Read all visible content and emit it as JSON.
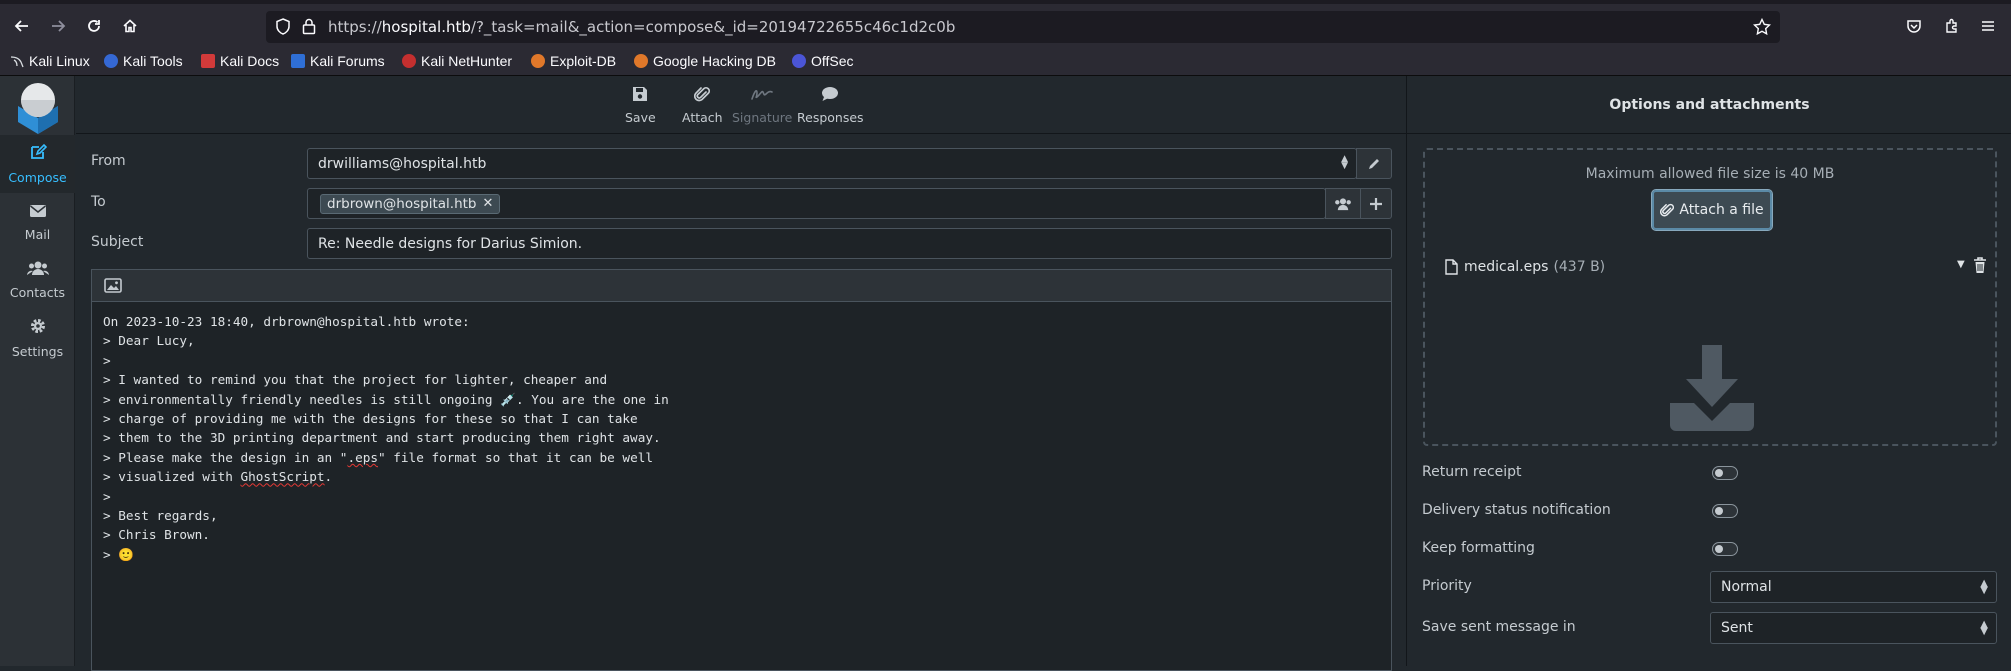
{
  "browser": {
    "url_prefix": "https://",
    "url_host": "hospital.htb",
    "url_rest": "/?_task=mail&_action=compose&_id=20194722655c46c1d2c0b",
    "bookmarks": [
      "Kali Linux",
      "Kali Tools",
      "Kali Docs",
      "Kali Forums",
      "Kali NetHunter",
      "Exploit-DB",
      "Google Hacking DB",
      "OffSec"
    ]
  },
  "rail": {
    "items": [
      {
        "label": "Compose",
        "icon": "compose-icon",
        "active": true
      },
      {
        "label": "Mail",
        "icon": "mail-icon"
      },
      {
        "label": "Contacts",
        "icon": "contacts-icon"
      },
      {
        "label": "Settings",
        "icon": "gear-icon"
      }
    ]
  },
  "toolbar": {
    "save": "Save",
    "attach": "Attach",
    "signature": "Signature",
    "responses": "Responses"
  },
  "form": {
    "from_label": "From",
    "from_value": "drwilliams@hospital.htb",
    "to_label": "To",
    "to_recipient": "drbrown@hospital.htb",
    "subject_label": "Subject",
    "subject_value": "Re: Needle designs for Darius Simion."
  },
  "body": {
    "lines": [
      "On 2023-10-23 18:40, drbrown@hospital.htb wrote:",
      "> Dear Lucy,",
      ">",
      "> I wanted to remind you that the project for lighter, cheaper and",
      "> environmentally friendly needles is still ongoing 💉. You are the one in",
      "> charge of providing me with the designs for these so that I can take",
      "> them to the 3D printing department and start producing them right away.",
      "> Please make the design in an \".eps\" file format so that it can be well",
      "> visualized with GhostScript.",
      ">",
      "> Best regards,",
      "> Chris Brown.",
      "> 🙂"
    ]
  },
  "panel": {
    "title": "Options and attachments",
    "max_size_note": "Maximum allowed file size is 40 MB",
    "attach_button": "Attach a file",
    "attachment_name": "medical.eps",
    "attachment_size": "(437 B)",
    "options": {
      "return_receipt": "Return receipt",
      "delivery_status": "Delivery status notification",
      "keep_formatting": "Keep formatting",
      "priority_label": "Priority",
      "priority_value": "Normal",
      "save_sent_label": "Save sent message in",
      "save_sent_value": "Sent"
    }
  },
  "colors": {
    "accent": "#37beff",
    "background": "#22282d",
    "rail": "#2c3136"
  }
}
